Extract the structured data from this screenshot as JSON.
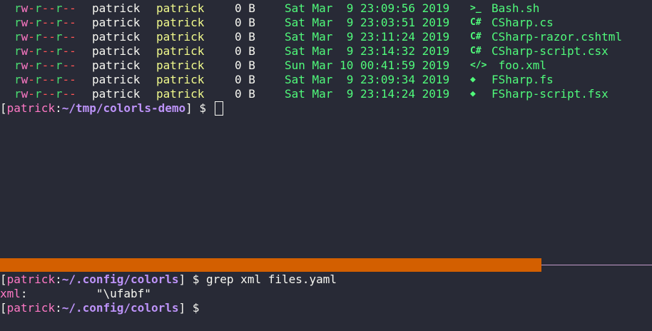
{
  "top_pane": {
    "listing": [
      {
        "perms": "rw-r--r--",
        "owner": "patrick",
        "group": "patrick",
        "size": "0 B",
        "date": "Sat Mar  9 23:09:56 2019",
        "icon": ">_",
        "name": "Bash.sh"
      },
      {
        "perms": "rw-r--r--",
        "owner": "patrick",
        "group": "patrick",
        "size": "0 B",
        "date": "Sat Mar  9 23:03:51 2019",
        "icon": "C#",
        "name": "CSharp.cs"
      },
      {
        "perms": "rw-r--r--",
        "owner": "patrick",
        "group": "patrick",
        "size": "0 B",
        "date": "Sat Mar  9 23:11:24 2019",
        "icon": "C#",
        "name": "CSharp-razor.cshtml"
      },
      {
        "perms": "rw-r--r--",
        "owner": "patrick",
        "group": "patrick",
        "size": "0 B",
        "date": "Sat Mar  9 23:14:32 2019",
        "icon": "C#",
        "name": "CSharp-script.csx"
      },
      {
        "perms": "rw-r--r--",
        "owner": "patrick",
        "group": "patrick",
        "size": "0 B",
        "date": "Sun Mar 10 00:41:59 2019",
        "icon": "</>",
        "name": " foo.xml"
      },
      {
        "perms": "rw-r--r--",
        "owner": "patrick",
        "group": "patrick",
        "size": "0 B",
        "date": "Sat Mar  9 23:09:34 2019",
        "icon": "◆",
        "name": "FSharp.fs"
      },
      {
        "perms": "rw-r--r--",
        "owner": "patrick",
        "group": "patrick",
        "size": "0 B",
        "date": "Sat Mar  9 23:14:24 2019",
        "icon": "◆",
        "name": "FSharp-script.fsx"
      }
    ],
    "prompt": {
      "open": "[",
      "user": "patrick",
      "colon": ":",
      "path": "~/tmp/colorls-demo",
      "close": "] ",
      "dollar": "$ "
    }
  },
  "bottom_pane": {
    "line1": {
      "open": "[",
      "user": "patrick",
      "colon": ":",
      "path": "~/.config/colorls",
      "close": "] ",
      "dollar": "$ ",
      "command": "grep xml files.yaml"
    },
    "line2": {
      "key": "xml",
      "colon": ":",
      "value": "          \"\\ufabf\""
    },
    "line3": {
      "open": "[",
      "user": "patrick",
      "colon": ":",
      "path": "~/.config/colorls",
      "close": "] ",
      "dollar": "$"
    }
  },
  "colors": {
    "background": "#282a36",
    "pane_divider": "#d35f00",
    "file_green": "#50fa7b",
    "group_yellow": "#f1fa8c",
    "prompt_pink": "#ff79c6",
    "path_purple": "#bd93f9"
  }
}
